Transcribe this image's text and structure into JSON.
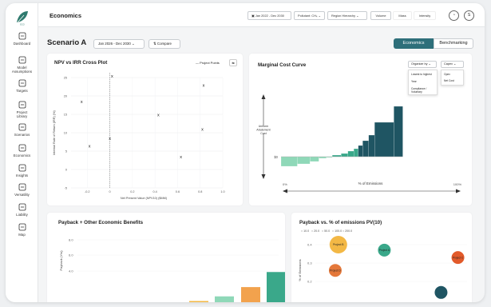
{
  "app": {
    "title": "Economics"
  },
  "sidebar": {
    "items": [
      {
        "label": "Dashboard",
        "icon": "grid-icon"
      },
      {
        "label": "Model\nAssumptions",
        "icon": "flow-icon"
      },
      {
        "label": "Targets",
        "icon": "target-icon"
      },
      {
        "label": "Project\nLibrary",
        "icon": "library-icon"
      },
      {
        "label": "Scenarios",
        "icon": "scenario-icon"
      },
      {
        "label": "Economics",
        "icon": "building-icon"
      },
      {
        "label": "Insights",
        "icon": "bulb-icon"
      },
      {
        "label": "Versatility",
        "icon": "steps-icon"
      },
      {
        "label": "Liability",
        "icon": "refresh-icon"
      },
      {
        "label": "Map",
        "icon": "map-icon"
      }
    ]
  },
  "topbar": {
    "date_range": "Jan 2022 - Dec 2030",
    "pollutant": "Pollutant: CH₄",
    "region": "Region Hierarchy",
    "btn_volume": "Volume",
    "btn_mass": "Mass",
    "btn_intensity": "Intensity",
    "avatar_letter": "S"
  },
  "scenario": {
    "title": "Scenario A",
    "date_range": "Jan 2026 - Dec 2030",
    "compare": "Compare",
    "tab_economics": "Economics",
    "tab_benchmarking": "Benchmarking"
  },
  "npv_chart": {
    "title": "NPV vs IRR Cross Plot",
    "legend": "Project Points"
  },
  "chart_data": [
    {
      "type": "scatter",
      "title": "NPV vs IRR Cross Plot",
      "xlabel": "Net Present Value (NPV10) ($MM)",
      "ylabel": "Internal Rate of Return (IRR) (%)",
      "xlim": [
        -0.4,
        1.0
      ],
      "ylim": [
        -5,
        25
      ],
      "xticks": [
        "-0.2",
        "0",
        "0.2",
        "0.4",
        "0.6",
        "0.8",
        "1.0"
      ],
      "yticks": [
        "25",
        "20",
        "15",
        "10",
        "5",
        "0",
        "-5"
      ],
      "grid": true,
      "points": [
        {
          "x": 0.02,
          "y": 25,
          "label": "x"
        },
        {
          "x": -0.25,
          "y": 18,
          "label": "x"
        },
        {
          "x": 0.83,
          "y": 22.5,
          "label": "x"
        },
        {
          "x": 0.43,
          "y": 14.5,
          "label": "x"
        },
        {
          "x": 0.82,
          "y": 10.5,
          "label": "x"
        },
        {
          "x": 0.0,
          "y": 8,
          "label": "x"
        },
        {
          "x": -0.18,
          "y": 6,
          "label": "x"
        },
        {
          "x": 0.63,
          "y": 3,
          "label": "x"
        }
      ]
    },
    {
      "type": "bar",
      "title": "Marginal Cost Curve",
      "ylabel": "Uniform Abatement Cost",
      "xlabel": "% of Emissions",
      "x_start": "0%",
      "x_end": "100%",
      "zero_label": "$0",
      "values": [
        -12,
        -9,
        -6,
        -2,
        -1,
        2,
        4,
        7,
        10,
        14,
        20,
        27,
        43,
        63
      ],
      "widths": [
        22,
        17,
        12,
        10,
        8,
        12,
        9,
        8,
        6,
        6,
        8,
        8,
        26,
        12
      ],
      "colors_negative": "#8fd8b8",
      "colors_positive_low": "#3aa88a",
      "colors_positive_high": "#1f5563",
      "organize_by": "Organize by",
      "organize_options": [
        "Lowest to highest",
        "Year",
        "Compliance / Voluntary"
      ],
      "capex": "Capex",
      "capex_options": [
        "Opex",
        "Net Cost"
      ]
    },
    {
      "type": "bar",
      "title": "Payback + Other Economic Benefits",
      "ylabel": "Payback (Yrs)",
      "yticks": [
        "8.0",
        "6.0",
        "4.0"
      ],
      "values": [
        1.0,
        1.4,
        2.2,
        3.5,
        5.6
      ],
      "colors": [
        "#f3b845",
        "#8fd8b8",
        "#f2a24d",
        "#3aa88a",
        "#1f5563"
      ]
    },
    {
      "type": "scatter",
      "title": "Payback vs. % of emissions PV(10)",
      "ylabel": "% of Emissions",
      "legend": [
        "10.0",
        "20.0",
        "50.0",
        "100.0",
        "200.0"
      ],
      "yticks": [
        "0.4",
        "0.3",
        "0.2"
      ],
      "points": [
        {
          "label": "Project B",
          "x": 0.15,
          "y": 0.4,
          "color": "#f3b845",
          "size": 11
        },
        {
          "label": "Project A",
          "x": 0.45,
          "y": 0.37,
          "color": "#3aa88a",
          "size": 8
        },
        {
          "label": "Project C",
          "x": 0.93,
          "y": 0.33,
          "color": "#e25a2a",
          "size": 8
        },
        {
          "label": "Project D",
          "x": 0.13,
          "y": 0.26,
          "color": "#e4783a",
          "size": 8
        },
        {
          "label": "",
          "x": 0.82,
          "y": 0.14,
          "color": "#1f5563",
          "size": 8
        }
      ]
    }
  ],
  "mcc_labels": {
    "title": "Marginal Cost Curve",
    "organize_by": "Organize by",
    "capex": "Capex",
    "organize_options": [
      "Lowest to highest",
      "Year",
      "Compliance / Voluntary"
    ],
    "capex_options": [
      "Opex",
      "Net Cost"
    ],
    "ylabel": "Uniform Abatement Cost",
    "zero": "$0",
    "x_start": "0%",
    "x_end": "100%",
    "xlabel": "% of Emissions"
  },
  "payback": {
    "title": "Payback + Other Economic Benefits",
    "ylabel": "Payback (Yrs)"
  },
  "pvchart": {
    "title": "Payback vs. % of emissions PV(10)",
    "ylabel": "% of Emissions"
  }
}
